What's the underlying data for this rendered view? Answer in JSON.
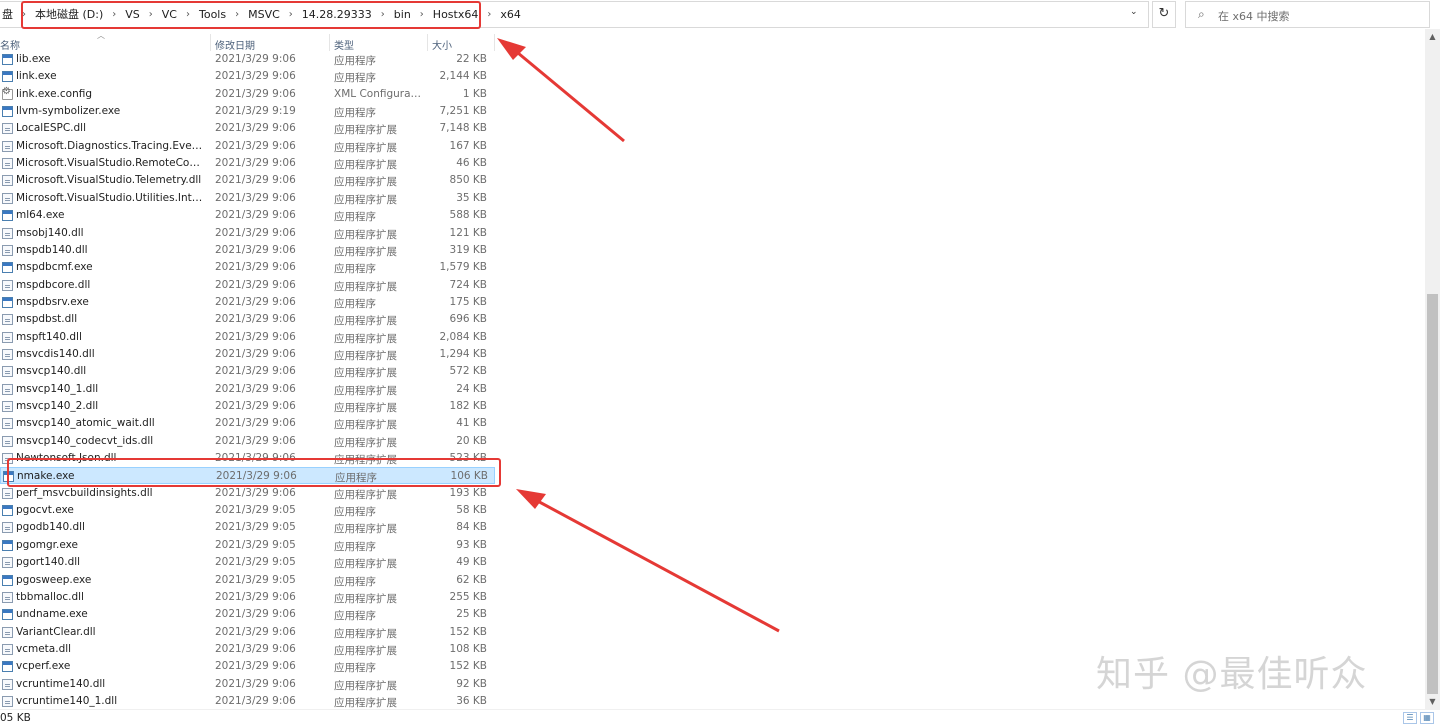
{
  "address": {
    "breadcrumbs": [
      "盘",
      "本地磁盘 (D:)",
      "VS",
      "VC",
      "Tools",
      "MSVC",
      "14.28.29333",
      "bin",
      "Hostx64",
      "x64"
    ],
    "dropdown_glyph": "⌄",
    "refresh_glyph": "↻"
  },
  "search": {
    "placeholder": "在 x64 中搜索",
    "icon": "search-icon"
  },
  "columns": {
    "name": "名称",
    "date": "修改日期",
    "type": "类型",
    "size": "大小"
  },
  "files": [
    {
      "name": "lib.exe",
      "date": "2021/3/29 9:06",
      "type": "应用程序",
      "size": "22 KB",
      "icon": "exe"
    },
    {
      "name": "link.exe",
      "date": "2021/3/29 9:06",
      "type": "应用程序",
      "size": "2,144 KB",
      "icon": "exe"
    },
    {
      "name": "link.exe.config",
      "date": "2021/3/29 9:06",
      "type": "XML Configurati...",
      "size": "1 KB",
      "icon": "cfg"
    },
    {
      "name": "llvm-symbolizer.exe",
      "date": "2021/3/29 9:19",
      "type": "应用程序",
      "size": "7,251 KB",
      "icon": "exe"
    },
    {
      "name": "LocalESPC.dll",
      "date": "2021/3/29 9:06",
      "type": "应用程序扩展",
      "size": "7,148 KB",
      "icon": "dll"
    },
    {
      "name": "Microsoft.Diagnostics.Tracing.EventS...",
      "date": "2021/3/29 9:06",
      "type": "应用程序扩展",
      "size": "167 KB",
      "icon": "dll"
    },
    {
      "name": "Microsoft.VisualStudio.RemoteContr...",
      "date": "2021/3/29 9:06",
      "type": "应用程序扩展",
      "size": "46 KB",
      "icon": "dll"
    },
    {
      "name": "Microsoft.VisualStudio.Telemetry.dll",
      "date": "2021/3/29 9:06",
      "type": "应用程序扩展",
      "size": "850 KB",
      "icon": "dll"
    },
    {
      "name": "Microsoft.VisualStudio.Utilities.Intern...",
      "date": "2021/3/29 9:06",
      "type": "应用程序扩展",
      "size": "35 KB",
      "icon": "dll"
    },
    {
      "name": "ml64.exe",
      "date": "2021/3/29 9:06",
      "type": "应用程序",
      "size": "588 KB",
      "icon": "exe"
    },
    {
      "name": "msobj140.dll",
      "date": "2021/3/29 9:06",
      "type": "应用程序扩展",
      "size": "121 KB",
      "icon": "dll"
    },
    {
      "name": "mspdb140.dll",
      "date": "2021/3/29 9:06",
      "type": "应用程序扩展",
      "size": "319 KB",
      "icon": "dll"
    },
    {
      "name": "mspdbcmf.exe",
      "date": "2021/3/29 9:06",
      "type": "应用程序",
      "size": "1,579 KB",
      "icon": "exe"
    },
    {
      "name": "mspdbcore.dll",
      "date": "2021/3/29 9:06",
      "type": "应用程序扩展",
      "size": "724 KB",
      "icon": "dll"
    },
    {
      "name": "mspdbsrv.exe",
      "date": "2021/3/29 9:06",
      "type": "应用程序",
      "size": "175 KB",
      "icon": "exe"
    },
    {
      "name": "mspdbst.dll",
      "date": "2021/3/29 9:06",
      "type": "应用程序扩展",
      "size": "696 KB",
      "icon": "dll"
    },
    {
      "name": "mspft140.dll",
      "date": "2021/3/29 9:06",
      "type": "应用程序扩展",
      "size": "2,084 KB",
      "icon": "dll"
    },
    {
      "name": "msvcdis140.dll",
      "date": "2021/3/29 9:06",
      "type": "应用程序扩展",
      "size": "1,294 KB",
      "icon": "dll"
    },
    {
      "name": "msvcp140.dll",
      "date": "2021/3/29 9:06",
      "type": "应用程序扩展",
      "size": "572 KB",
      "icon": "dll"
    },
    {
      "name": "msvcp140_1.dll",
      "date": "2021/3/29 9:06",
      "type": "应用程序扩展",
      "size": "24 KB",
      "icon": "dll"
    },
    {
      "name": "msvcp140_2.dll",
      "date": "2021/3/29 9:06",
      "type": "应用程序扩展",
      "size": "182 KB",
      "icon": "dll"
    },
    {
      "name": "msvcp140_atomic_wait.dll",
      "date": "2021/3/29 9:06",
      "type": "应用程序扩展",
      "size": "41 KB",
      "icon": "dll"
    },
    {
      "name": "msvcp140_codecvt_ids.dll",
      "date": "2021/3/29 9:06",
      "type": "应用程序扩展",
      "size": "20 KB",
      "icon": "dll"
    },
    {
      "name": "Newtonsoft.Json.dll",
      "date": "2021/3/29 9:06",
      "type": "应用程序扩展",
      "size": "523 KB",
      "icon": "dll"
    },
    {
      "name": "nmake.exe",
      "date": "2021/3/29 9:06",
      "type": "应用程序",
      "size": "106 KB",
      "icon": "exe",
      "selected": true
    },
    {
      "name": "perf_msvcbuildinsights.dll",
      "date": "2021/3/29 9:06",
      "type": "应用程序扩展",
      "size": "193 KB",
      "icon": "dll"
    },
    {
      "name": "pgocvt.exe",
      "date": "2021/3/29 9:05",
      "type": "应用程序",
      "size": "58 KB",
      "icon": "exe"
    },
    {
      "name": "pgodb140.dll",
      "date": "2021/3/29 9:05",
      "type": "应用程序扩展",
      "size": "84 KB",
      "icon": "dll"
    },
    {
      "name": "pgomgr.exe",
      "date": "2021/3/29 9:05",
      "type": "应用程序",
      "size": "93 KB",
      "icon": "exe"
    },
    {
      "name": "pgort140.dll",
      "date": "2021/3/29 9:05",
      "type": "应用程序扩展",
      "size": "49 KB",
      "icon": "dll"
    },
    {
      "name": "pgosweep.exe",
      "date": "2021/3/29 9:05",
      "type": "应用程序",
      "size": "62 KB",
      "icon": "exe"
    },
    {
      "name": "tbbmalloc.dll",
      "date": "2021/3/29 9:06",
      "type": "应用程序扩展",
      "size": "255 KB",
      "icon": "dll"
    },
    {
      "name": "undname.exe",
      "date": "2021/3/29 9:06",
      "type": "应用程序",
      "size": "25 KB",
      "icon": "exe"
    },
    {
      "name": "VariantClear.dll",
      "date": "2021/3/29 9:06",
      "type": "应用程序扩展",
      "size": "152 KB",
      "icon": "dll"
    },
    {
      "name": "vcmeta.dll",
      "date": "2021/3/29 9:06",
      "type": "应用程序扩展",
      "size": "108 KB",
      "icon": "dll"
    },
    {
      "name": "vcperf.exe",
      "date": "2021/3/29 9:06",
      "type": "应用程序",
      "size": "152 KB",
      "icon": "exe"
    },
    {
      "name": "vcruntime140.dll",
      "date": "2021/3/29 9:06",
      "type": "应用程序扩展",
      "size": "92 KB",
      "icon": "dll"
    },
    {
      "name": "vcruntime140_1.dll",
      "date": "2021/3/29 9:06",
      "type": "应用程序扩展",
      "size": "36 KB",
      "icon": "dll"
    }
  ],
  "status": {
    "text": "05 KB"
  },
  "watermark": "知乎 @最佳听众",
  "colors": {
    "accent_red": "#e53935",
    "selection": "#cce8ff",
    "selection_border": "#99d1ff"
  }
}
